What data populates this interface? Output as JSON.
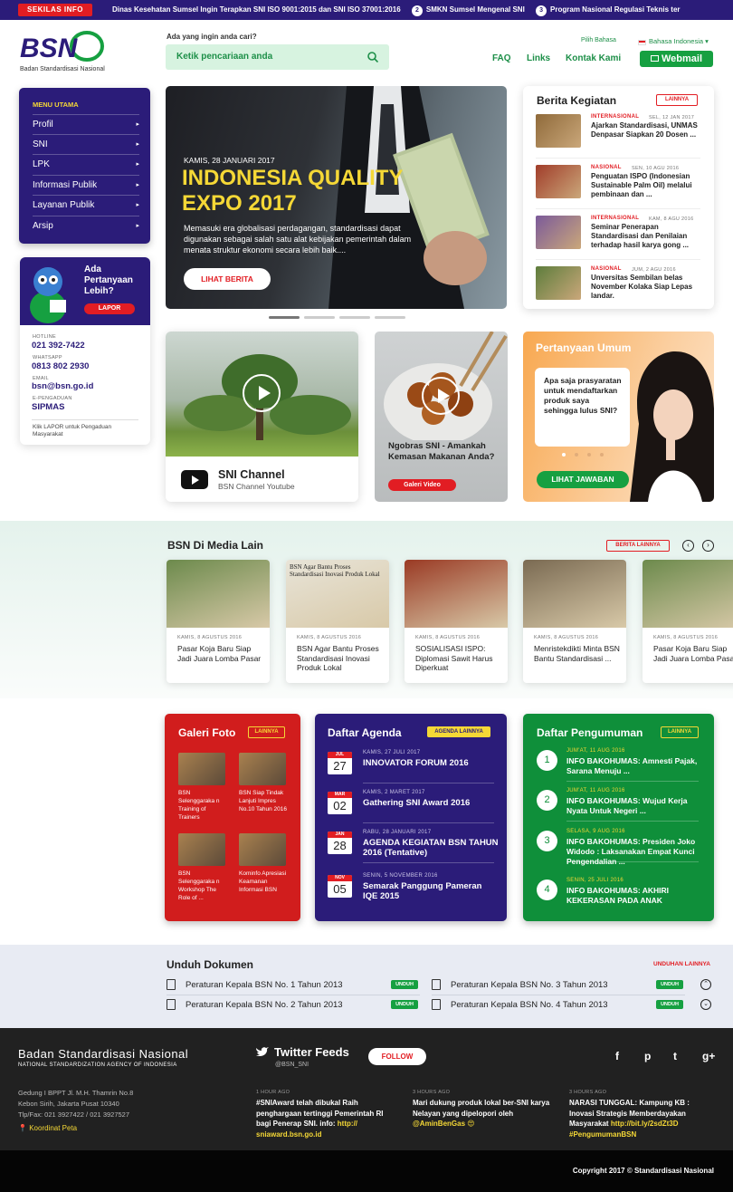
{
  "ticker": {
    "label": "SEKILAS INFO",
    "items": [
      {
        "num": "",
        "text": "Dinas Kesehatan Sumsel Ingin Terapkan SNI ISO 9001:2015 dan SNI ISO 37001:2016"
      },
      {
        "num": "2",
        "text": "SMKN Sumsel Mengenal SNI"
      },
      {
        "num": "3",
        "text": "Program Nasional Regulasi Teknis ter"
      }
    ]
  },
  "header": {
    "logo": "BSN",
    "org": "Badan Standardisasi Nasional",
    "search_label": "Ada yang ingin anda cari?",
    "search_placeholder": "Ketik pencariaan anda",
    "lang_label": "Pilih Bahasa",
    "lang_value": "Bahasa Indonesia ▾",
    "links": [
      "FAQ",
      "Links",
      "Kontak Kami"
    ],
    "webmail": "Webmail"
  },
  "menu": {
    "title": "MENU UTAMA",
    "items": [
      "Profil",
      "SNI",
      "LPK",
      "Informasi Publik",
      "Layanan Publik",
      "Arsip"
    ],
    "arrow": "▸"
  },
  "ask": {
    "title": "Ada Pertanyaan Lebih?",
    "button": "LAPOR",
    "contacts": [
      {
        "label": "HOTLINE",
        "value": "021 392-7422"
      },
      {
        "label": "WHATSAPP",
        "value": "0813 802 2930"
      },
      {
        "label": "EMAIL",
        "value": "bsn@bsn.go.id"
      },
      {
        "label": "E-PENGADUAN",
        "value": "SIPMAS"
      }
    ],
    "note": "Klik LAPOR untuk Pengaduan Masyarakat"
  },
  "hero": {
    "date": "KAMIS, 28 JANUARI 2017",
    "title": "INDONESIA QUALITY EXPO 2017",
    "desc": "Memasuki era globalisasi perdagangan, standardisasi dapat digunakan sebagai salah satu alat kebijakan pemerintah dalam menata struktur ekonomi secara lebih baik....",
    "button": "LIHAT BERITA"
  },
  "berita": {
    "title": "Berita Kegiatan",
    "more": "LAINNYA",
    "items": [
      {
        "cat": "INTERNASIONAL",
        "date": "SEL, 12 JAN 2017",
        "title": "Ajarkan Standardisasi, UNMAS Denpasar Siapkan 20 Dosen ..."
      },
      {
        "cat": "NASIONAL",
        "date": "SEN, 10 AGU 2016",
        "title": "Penguatan ISPO (Indonesian Sustainable Palm Oil) melalui pembinaan dan ..."
      },
      {
        "cat": "INTERNASIONAL",
        "date": "KAM, 8 AGU 2016",
        "title": "Seminar Penerapan Standardisasi dan Penilaian terhadap hasil karya gong ..."
      },
      {
        "cat": "NASIONAL",
        "date": "JUM, 2 AGU 2016",
        "title": "Unversitas Sembilan belas November Kolaka Siap Lepas landar."
      }
    ]
  },
  "channel": {
    "title": "SNI Channel",
    "subtitle": "BSN Channel Youtube"
  },
  "video": {
    "title": "Ngobras SNI - Amankah Kemasan Makanan Anda?",
    "button": "Galeri Video"
  },
  "faq": {
    "title": "Pertanyaan Umum",
    "question": "Apa saja prasyaratan untuk mendaftarkan produk saya sehingga lulus SNI?",
    "button": "LIHAT JAWABAN"
  },
  "media": {
    "title": "BSN Di Media Lain",
    "more": "BERITA LAINNYA",
    "items": [
      {
        "date": "KAMIS, 8 AGUSTUS 2016",
        "title": "Pasar Koja Baru Siap Jadi Juara Lomba Pasar"
      },
      {
        "date": "KAMIS, 8 AGUSTUS 2016",
        "title": "BSN Agar Bantu Proses Standardisasi Inovasi Produk Lokal",
        "clip": "BSN Agar Bantu Proses Standardisasi Inovasi Produk Lokal"
      },
      {
        "date": "KAMIS, 8 AGUSTUS 2016",
        "title": "SOSIALISASI ISPO: Diplomasi Sawit Harus Diperkuat"
      },
      {
        "date": "KAMIS, 8 AGUSTUS 2016",
        "title": "Menristekdikti Minta BSN Bantu Standardisasi ..."
      },
      {
        "date": "KAMIS, 8 AGUSTUS 2016",
        "title": "Pasar Koja Baru Siap Jadi Juara Lomba Pasar"
      }
    ]
  },
  "galeri": {
    "title": "Galeri Foto",
    "more": "LAINNYA",
    "items": [
      "BSN Selenggaraka n Training of Trainers",
      "BSN Siap Tindak Lanjuti Impres No.10 Tahun 2016",
      "BSN Selenggaraka n Workshop The Role of ...",
      "Kominfo Apresiasi Keamanan Informasi BSN"
    ]
  },
  "agenda": {
    "title": "Daftar Agenda",
    "more": "AGENDA LAINNYA",
    "items": [
      {
        "mon": "JUL",
        "day": "27",
        "date": "KAMIS, 27 JULI 2017",
        "title": "INNOVATOR FORUM 2016"
      },
      {
        "mon": "MAR",
        "day": "02",
        "date": "KAMIS, 2 MARET 2017",
        "title": "Gathering SNI Award 2016"
      },
      {
        "mon": "JAN",
        "day": "28",
        "date": "RABU, 28 JANUARI 2017",
        "title": "AGENDA KEGIATAN BSN TAHUN 2016 (Tentative)"
      },
      {
        "mon": "NOV",
        "day": "05",
        "date": "SENIN, 5 NOVEMBER 2016",
        "title": "Semarak Panggung Pameran IQE 2015"
      }
    ]
  },
  "pengumuman": {
    "title": "Daftar Pengumuman",
    "more": "LAINNYA",
    "items": [
      {
        "n": "1",
        "date": "JUM'AT, 11 AUG 2016",
        "title": "INFO BAKOHUMAS: Amnesti Pajak, Sarana Menuju ..."
      },
      {
        "n": "2",
        "date": "JUM'AT, 11 AUG 2016",
        "title": "INFO BAKOHUMAS: Wujud Kerja Nyata Untuk Negeri ..."
      },
      {
        "n": "3",
        "date": "SELASA, 9 AUG 2016",
        "title": "INFO BAKOHUMAS: Presiden Joko Widodo : Laksanakan Empat Kunci Pengendalian ..."
      },
      {
        "n": "4",
        "date": "SENIN, 25 JULI 2016",
        "title": "INFO BAKOHUMAS: AKHIRI KEKERASAN PADA ANAK"
      }
    ]
  },
  "unduh": {
    "title": "Unduh Dokumen",
    "more": "UNDUHAN LAINNYA",
    "button": "UNDUH",
    "items": [
      "Peraturan Kepala BSN No. 1 Tahun 2013",
      "Peraturan Kepala BSN No. 3 Tahun 2013",
      "Peraturan Kepala BSN No. 2 Tahun 2013",
      "Peraturan Kepala BSN No. 4 Tahun 2013"
    ]
  },
  "footer": {
    "org": "Badan Standardisasi Nasional",
    "org_en": "NATIONAL STANDARDIZATION AGENCY OF INDONESIA",
    "address": [
      "Gedung I BPPT Jl. M.H. Thamrin No.8",
      "Kebon Sirih, Jakarta Pusat 10340",
      "Tlp/Fax: 021 3927422 / 021 3927527"
    ],
    "map": "Koordinat Peta",
    "twitter_title": "Twitter Feeds",
    "twitter_handle": "@BSN_SNI",
    "follow": "FOLLOW",
    "tweets": [
      {
        "time": "1 HOUR AGO",
        "text": "#SNIAward telah dibukal Raih penghargaan tertinggi Pemerintah RI bagi Penerap SNI. info: ",
        "link": "http:// sniaward.bsn.go.id"
      },
      {
        "time": "3 HOURS AGO",
        "text": "Mari dukung produk lokal ber-SNI karya Nelayan yang dipelopori oleh ",
        "link": "@AminBenGas 😍"
      },
      {
        "time": "3 HOURS AGO",
        "text": "NARASI TUNGGAL: Kampung KB : Inovasi Strategis Memberdayakan Masyarakat ",
        "link": "http://bit.ly/2sdZt3D #PengumumanBSN"
      }
    ],
    "social": [
      "f",
      "p",
      "t",
      "g+"
    ],
    "copyright": "Copyright 2017 © Standardisasi Nasional"
  },
  "colors": {
    "navy": "#2b1c79",
    "red": "#e21d23",
    "green": "#16a041",
    "yellow": "#f5d836",
    "orange": "#f8a850"
  }
}
